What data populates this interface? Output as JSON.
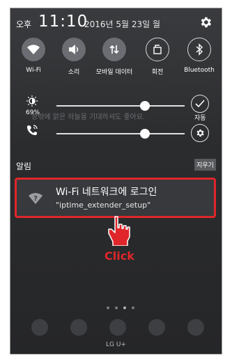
{
  "status": {
    "ampm": "오후",
    "time": "11:10",
    "date": "2016년 5월 23일 월"
  },
  "quick_settings": [
    {
      "label": "Wi-Fi",
      "icon": "wifi-icon",
      "state": "on"
    },
    {
      "label": "소리",
      "icon": "sound-icon",
      "state": "on"
    },
    {
      "label": "모바일 데이터",
      "icon": "mobile-data-icon",
      "state": "on"
    },
    {
      "label": "회전",
      "icon": "rotate-icon",
      "state": "off"
    },
    {
      "label": "Bluetooth",
      "icon": "bluetooth-icon",
      "state": "off"
    }
  ],
  "brightness": {
    "percent_label": "69%",
    "level": 0.69,
    "auto_label": "자동"
  },
  "volume": {
    "level": 0.69
  },
  "background_text": "창밖에 맑은 하늘을 기대하셔도 좋아요.",
  "notifications": {
    "section_label": "알림",
    "clear_label": "지우기",
    "items": [
      {
        "title": "Wi-Fi 네트워크에 로그인",
        "subtitle": "\"iptime_extender_setup\"",
        "icon": "wifi-question-icon"
      }
    ]
  },
  "annotation": {
    "click_label": "Click"
  },
  "carrier": "LG U+",
  "colors": {
    "highlight": "#e0262b",
    "panel": "#2a2b2d",
    "toggle_on": "#6b6d72"
  }
}
